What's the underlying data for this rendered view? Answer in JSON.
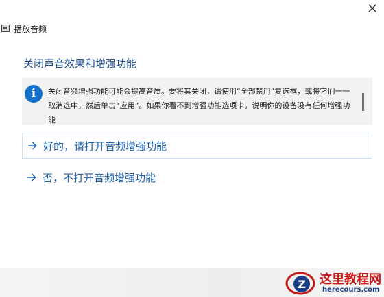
{
  "window": {
    "title": "播放音频",
    "close_glyph": "×"
  },
  "main": {
    "heading": "关闭声音效果和增强功能",
    "info": {
      "icon": "info-icon",
      "icon_glyph": "i",
      "text": "关闭音频增强功能可能会提高音质。要将其关闭，请使用“全部禁用”复选框，或将它们一一取消选中，然后单击“应用”。如果你看不到增强功能选项卡，说明你的设备没有任何增强功能"
    },
    "options": [
      {
        "label": "好的，请打开音频增强功能",
        "icon": "arrow-right-icon",
        "selected": true
      },
      {
        "label": "否，不打开音频增强功能",
        "icon": "arrow-right-icon",
        "selected": false
      }
    ]
  },
  "watermark": {
    "logo_letter": "Z",
    "title": "这里教程网",
    "url": "herecours.com"
  },
  "colors": {
    "heading": "#1e4c8f",
    "link": "#1c61ad",
    "info_icon": "#1570c9",
    "watermark_title": "#c51a1a"
  }
}
